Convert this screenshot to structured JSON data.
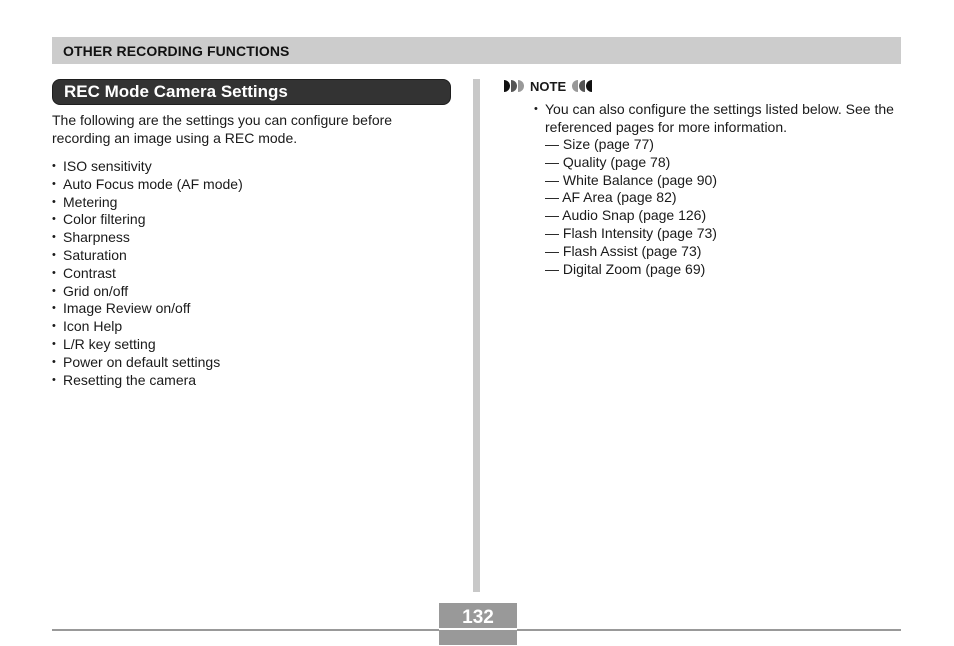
{
  "header": {
    "chapter": "OTHER RECORDING FUNCTIONS"
  },
  "section": {
    "title": "REC Mode Camera Settings",
    "intro": "The following are the settings you can configure before recording an image using a REC mode.",
    "items": [
      "ISO sensitivity",
      "Auto Focus mode (AF mode)",
      "Metering",
      "Color filtering",
      "Sharpness",
      "Saturation",
      "Contrast",
      "Grid on/off",
      "Image Review on/off",
      "Icon Help",
      "L/R key setting",
      "Power on default settings",
      "Resetting the camera"
    ]
  },
  "note": {
    "label": "NOTE",
    "icon_left": "note-arrows-right-icon",
    "icon_right": "note-arrows-left-icon",
    "text": "You can also configure the settings listed below. See the referenced pages for more information.",
    "refs": [
      "Size (page 77)",
      "Quality (page 78)",
      "White Balance (page 90)",
      "AF Area (page 82)",
      "Audio Snap (page 126)",
      "Flash Intensity (page 73)",
      "Flash Assist (page 73)",
      "Digital Zoom (page 69)"
    ]
  },
  "footer": {
    "page_number": "132"
  }
}
